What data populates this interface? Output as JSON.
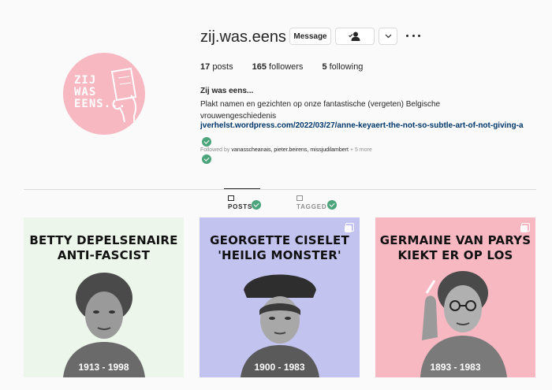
{
  "profile": {
    "username": "zij.was.eens",
    "avatar_text": [
      "ZIJ",
      "WAS",
      "EENS..."
    ],
    "message_label": "Message",
    "follow_icon": "person-check-icon",
    "dropdown_icon": "chevron-down-icon",
    "more_icon": "more-horizontal-icon"
  },
  "stats": {
    "posts_count": "17",
    "posts_label": "posts",
    "followers_count": "165",
    "followers_label": "followers",
    "following_count": "5",
    "following_label": "following"
  },
  "bio": {
    "full_name": "Zij was eens...",
    "text": "Plakt namen en gezichten op onze fantastische (vergeten) Belgische vrouwengeschiedenis",
    "link": "jverhelst.wordpress.com/2022/03/27/anne-keyaert-the-not-so-subtle-art-of-not-giving-a",
    "followed_by_prefix": "Followed by",
    "followed_by_users": "vanasscheanais, pieter.beirens, missjudilambert",
    "followed_by_more": "+ 5 more"
  },
  "tabs": [
    {
      "label": "POSTS",
      "icon": "grid-icon",
      "active": true
    },
    {
      "label": "TAGGED",
      "icon": "tag-icon",
      "active": false
    }
  ],
  "posts": [
    {
      "title_line1": "BETTY DEPELSENAIRE",
      "title_line2": "ANTI-FASCIST",
      "years": "1913 - 1998",
      "bg": "#ecf6ea"
    },
    {
      "title_line1": "GEORGETTE CISELET",
      "title_line2": "'HEILIG MONSTER'",
      "years": "1900 - 1983",
      "bg": "#c3c3ef"
    },
    {
      "title_line1": "GERMAINE VAN PARYS",
      "title_line2": "KIEKT ER OP LOS",
      "years": "1893 - 1983",
      "bg": "#f7b8c2"
    }
  ],
  "colors": {
    "accent_check": "#4ca47a",
    "link": "#00376b",
    "avatar_bg": "#f7b8c2"
  }
}
